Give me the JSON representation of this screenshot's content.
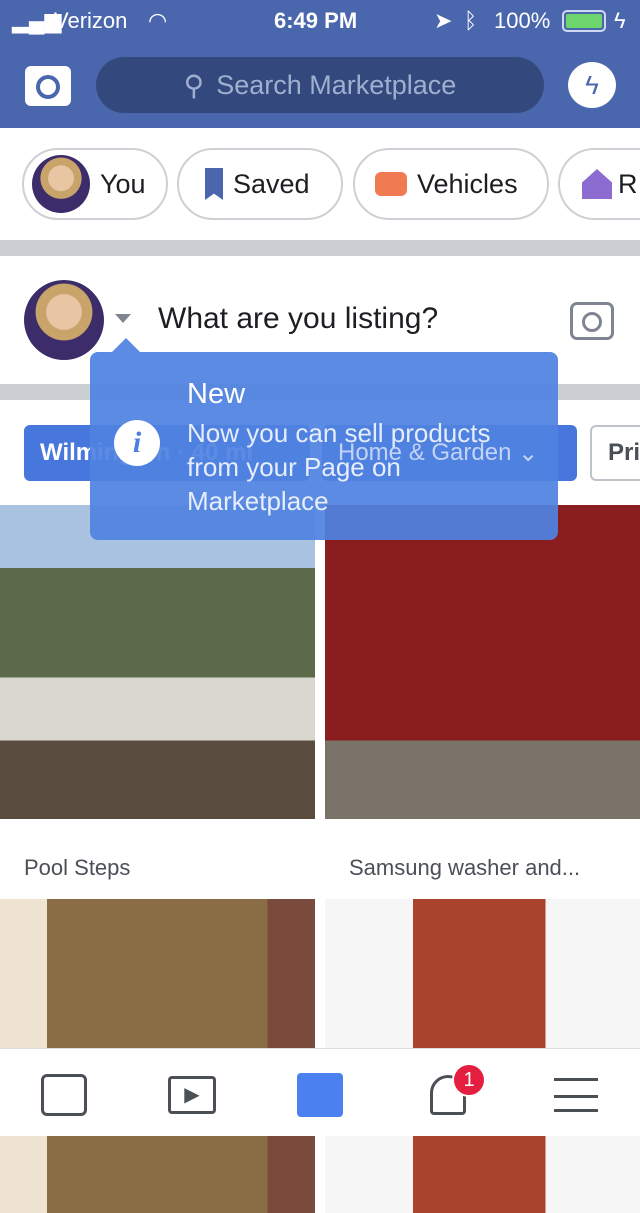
{
  "status": {
    "carrier": "Verizon",
    "time": "6:49 PM",
    "battery": "100%",
    "battery_color": "#6cd56c"
  },
  "header": {
    "search_placeholder": "Search Marketplace",
    "brand_color": "#4a67ad"
  },
  "chips": [
    {
      "label": "You",
      "icon": "avatar"
    },
    {
      "label": "Saved",
      "icon": "bookmark-icon",
      "color": "#4a67ad"
    },
    {
      "label": "Vehicles",
      "icon": "car-icon",
      "color": "#f07b52"
    },
    {
      "label": "R",
      "icon": "house-icon",
      "color": "#8c6cd1"
    }
  ],
  "composer": {
    "prompt": "What are you listing?"
  },
  "filters": {
    "location": "Wilmington · 40 mi",
    "category": "Home & Garden",
    "price": "Pri"
  },
  "tooltip": {
    "title": "New",
    "body": "Now you can sell products from your Page on Marketplace"
  },
  "listings": [
    {
      "title": "Pool Steps"
    },
    {
      "title": "Samsung washer and..."
    },
    {
      "title": ""
    },
    {
      "title": ""
    }
  ],
  "bottom_nav": {
    "notifications_badge": "1",
    "active": "marketplace",
    "accent": "#4a80f0"
  }
}
